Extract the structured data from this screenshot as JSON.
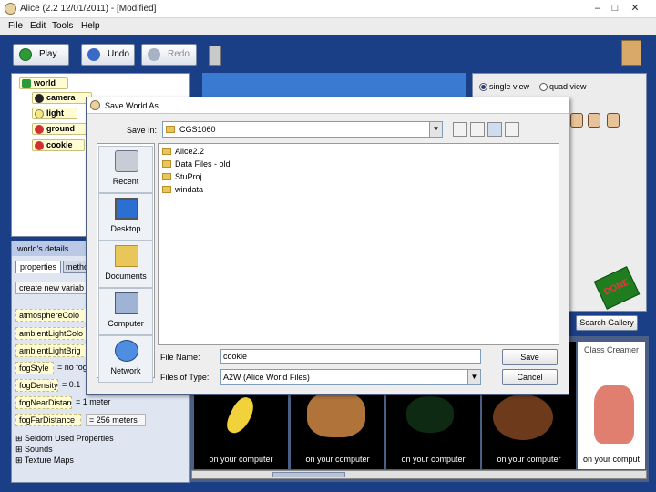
{
  "window": {
    "title": "Alice (2.2  12/01/2011) - [Modified]",
    "min_glyph": "–",
    "max_glyph": "□",
    "close_glyph": "✕"
  },
  "menu": {
    "file": "File",
    "edit": "Edit",
    "tools": "Tools",
    "help": "Help"
  },
  "toolbar": {
    "play": "Play",
    "undo": "Undo",
    "redo": "Redo"
  },
  "tree": {
    "root": "world",
    "items": [
      "camera",
      "light",
      "ground",
      "cookie"
    ]
  },
  "details": {
    "title": "world's details",
    "tabs": [
      "properties",
      "metho"
    ],
    "create_var": "create new variab",
    "properties": [
      {
        "name": "atmosphereColo",
        "value": ""
      },
      {
        "name": "ambientLightColo",
        "value": ""
      },
      {
        "name": "ambientLightBrig",
        "value": ""
      },
      {
        "name": "fogStyle",
        "value": "= no fog"
      },
      {
        "name": "fogDensity",
        "value": "= 0.1"
      },
      {
        "name": "fogNearDistance",
        "value": "= 1 meter"
      },
      {
        "name": "fogFarDistance",
        "value": "= 256 meters"
      }
    ],
    "expanders": [
      "Seldom Used Properties",
      "Sounds",
      "Texture Maps"
    ]
  },
  "views": {
    "single": "single view",
    "quad": "quad view"
  },
  "gallery": {
    "search": "Search Gallery",
    "done": "DONE",
    "tiles": [
      {
        "caption": "on your computer",
        "label": ""
      },
      {
        "caption": "on your computer",
        "label": ""
      },
      {
        "caption": "on your computer",
        "label": ""
      },
      {
        "caption": "on your computer",
        "label": ""
      },
      {
        "caption": "on your comput",
        "label": "Class Creamer"
      }
    ]
  },
  "dialog": {
    "title": "Save World As...",
    "save_in_label": "Save In:",
    "save_in_value": "CGS1060",
    "places": [
      "Recent",
      "Desktop",
      "Documents",
      "Computer",
      "Network"
    ],
    "files": [
      "Alice2.2",
      "Data Files - old",
      "StuProj",
      "windata"
    ],
    "file_name_label": "File Name:",
    "file_name_value": "cookie",
    "files_of_type_label": "Files of Type:",
    "files_of_type_value": "A2W (Alice World Files)",
    "save": "Save",
    "cancel": "Cancel"
  },
  "colors": {
    "app_blue": "#1b3f86",
    "tree_item_bg": "#fffbd2",
    "dialog_bg": "#eeeeee"
  }
}
